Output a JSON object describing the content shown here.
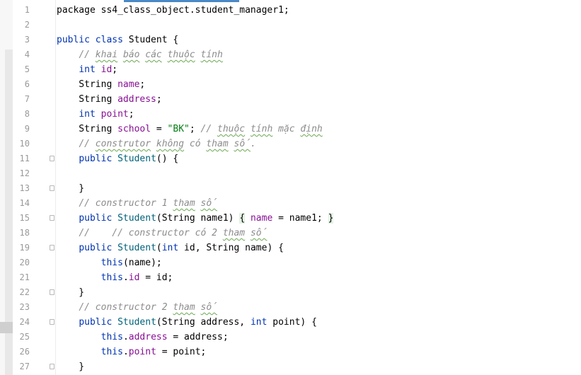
{
  "editor": {
    "lines": [
      {
        "num": "1",
        "fold": false,
        "tokens": [
          {
            "t": "package ss4_class_object.student_manager1;",
            "c": ""
          }
        ]
      },
      {
        "num": "2",
        "fold": false,
        "tokens": []
      },
      {
        "num": "3",
        "fold": false,
        "tokens": [
          {
            "t": "public class ",
            "c": "kw"
          },
          {
            "t": "Student {",
            "c": ""
          }
        ]
      },
      {
        "num": "4",
        "fold": false,
        "tokens": [
          {
            "t": "    ",
            "c": ""
          },
          {
            "t": "// ",
            "c": "cm"
          },
          {
            "t": "khai",
            "c": "cm sq"
          },
          {
            "t": " ",
            "c": "cm"
          },
          {
            "t": "báo",
            "c": "cm sq"
          },
          {
            "t": " ",
            "c": "cm"
          },
          {
            "t": "các",
            "c": "cm sq"
          },
          {
            "t": " ",
            "c": "cm"
          },
          {
            "t": "thuộc",
            "c": "cm sq"
          },
          {
            "t": " ",
            "c": "cm"
          },
          {
            "t": "tính",
            "c": "cm sq"
          }
        ]
      },
      {
        "num": "5",
        "fold": false,
        "tokens": [
          {
            "t": "    ",
            "c": ""
          },
          {
            "t": "int ",
            "c": "kw"
          },
          {
            "t": "id",
            "c": "fld"
          },
          {
            "t": ";",
            "c": ""
          }
        ]
      },
      {
        "num": "6",
        "fold": false,
        "tokens": [
          {
            "t": "    String ",
            "c": ""
          },
          {
            "t": "name",
            "c": "fld"
          },
          {
            "t": ";",
            "c": ""
          }
        ]
      },
      {
        "num": "7",
        "fold": false,
        "tokens": [
          {
            "t": "    String ",
            "c": ""
          },
          {
            "t": "address",
            "c": "fld"
          },
          {
            "t": ";",
            "c": ""
          }
        ]
      },
      {
        "num": "8",
        "fold": false,
        "tokens": [
          {
            "t": "    ",
            "c": ""
          },
          {
            "t": "int ",
            "c": "kw"
          },
          {
            "t": "point",
            "c": "fld"
          },
          {
            "t": ";",
            "c": ""
          }
        ]
      },
      {
        "num": "9",
        "fold": false,
        "tokens": [
          {
            "t": "    String ",
            "c": ""
          },
          {
            "t": "school",
            "c": "fld"
          },
          {
            "t": " = ",
            "c": ""
          },
          {
            "t": "\"BK\"",
            "c": "str"
          },
          {
            "t": "; ",
            "c": ""
          },
          {
            "t": "// ",
            "c": "cm"
          },
          {
            "t": "thuộc",
            "c": "cm sq"
          },
          {
            "t": " ",
            "c": "cm"
          },
          {
            "t": "tính",
            "c": "cm sq"
          },
          {
            "t": " mặc ",
            "c": "cm"
          },
          {
            "t": "định",
            "c": "cm sq"
          }
        ]
      },
      {
        "num": "10",
        "fold": false,
        "tokens": [
          {
            "t": "    ",
            "c": ""
          },
          {
            "t": "// ",
            "c": "cm"
          },
          {
            "t": "construtor",
            "c": "cm sq"
          },
          {
            "t": " ",
            "c": "cm"
          },
          {
            "t": "không",
            "c": "cm sq"
          },
          {
            "t": " có ",
            "c": "cm"
          },
          {
            "t": "tham",
            "c": "cm sq"
          },
          {
            "t": " ",
            "c": "cm"
          },
          {
            "t": "số",
            "c": "cm sq"
          },
          {
            "t": ".",
            "c": "cm"
          }
        ]
      },
      {
        "num": "11",
        "fold": true,
        "tokens": [
          {
            "t": "    ",
            "c": ""
          },
          {
            "t": "public ",
            "c": "kw"
          },
          {
            "t": "Student",
            "c": "ctor"
          },
          {
            "t": "() {",
            "c": ""
          }
        ]
      },
      {
        "num": "12",
        "fold": false,
        "tokens": []
      },
      {
        "num": "13",
        "fold": true,
        "tokens": [
          {
            "t": "    }",
            "c": ""
          }
        ]
      },
      {
        "num": "14",
        "fold": false,
        "tokens": [
          {
            "t": "    ",
            "c": ""
          },
          {
            "t": "// constructor 1 ",
            "c": "cm"
          },
          {
            "t": "tham",
            "c": "cm sq"
          },
          {
            "t": " ",
            "c": "cm"
          },
          {
            "t": "số",
            "c": "cm sq"
          }
        ]
      },
      {
        "num": "15",
        "fold": true,
        "tokens": [
          {
            "t": "    ",
            "c": ""
          },
          {
            "t": "public ",
            "c": "kw"
          },
          {
            "t": "Student",
            "c": "ctor"
          },
          {
            "t": "(String name1) ",
            "c": ""
          },
          {
            "t": "{",
            "c": "fh"
          },
          {
            "t": " ",
            "c": ""
          },
          {
            "t": "name",
            "c": "fld"
          },
          {
            "t": " = name1; ",
            "c": ""
          },
          {
            "t": "}",
            "c": "fh"
          }
        ]
      },
      {
        "num": "18",
        "fold": false,
        "tokens": [
          {
            "t": "    ",
            "c": ""
          },
          {
            "t": "//    // constructor có 2 ",
            "c": "cm"
          },
          {
            "t": "tham",
            "c": "cm sq"
          },
          {
            "t": " ",
            "c": "cm"
          },
          {
            "t": "số",
            "c": "cm sq"
          }
        ]
      },
      {
        "num": "19",
        "fold": true,
        "tokens": [
          {
            "t": "    ",
            "c": ""
          },
          {
            "t": "public ",
            "c": "kw"
          },
          {
            "t": "Student",
            "c": "ctor"
          },
          {
            "t": "(",
            "c": ""
          },
          {
            "t": "int ",
            "c": "kw"
          },
          {
            "t": "id, String name) {",
            "c": ""
          }
        ]
      },
      {
        "num": "20",
        "fold": false,
        "tokens": [
          {
            "t": "        ",
            "c": ""
          },
          {
            "t": "this",
            "c": "kw"
          },
          {
            "t": "(name);",
            "c": ""
          }
        ]
      },
      {
        "num": "21",
        "fold": false,
        "tokens": [
          {
            "t": "        ",
            "c": ""
          },
          {
            "t": "this",
            "c": "kw"
          },
          {
            "t": ".",
            "c": ""
          },
          {
            "t": "id",
            "c": "fld"
          },
          {
            "t": " = id;",
            "c": ""
          }
        ]
      },
      {
        "num": "22",
        "fold": true,
        "tokens": [
          {
            "t": "    }",
            "c": ""
          }
        ]
      },
      {
        "num": "23",
        "fold": false,
        "tokens": [
          {
            "t": "    ",
            "c": ""
          },
          {
            "t": "// constructor 2 ",
            "c": "cm"
          },
          {
            "t": "tham",
            "c": "cm sq"
          },
          {
            "t": " ",
            "c": "cm"
          },
          {
            "t": "số",
            "c": "cm sq"
          }
        ]
      },
      {
        "num": "24",
        "fold": true,
        "tokens": [
          {
            "t": "    ",
            "c": ""
          },
          {
            "t": "public ",
            "c": "kw"
          },
          {
            "t": "Student",
            "c": "ctor"
          },
          {
            "t": "(String address, ",
            "c": ""
          },
          {
            "t": "int ",
            "c": "kw"
          },
          {
            "t": "point) {",
            "c": ""
          }
        ]
      },
      {
        "num": "25",
        "fold": false,
        "tokens": [
          {
            "t": "        ",
            "c": ""
          },
          {
            "t": "this",
            "c": "kw"
          },
          {
            "t": ".",
            "c": ""
          },
          {
            "t": "address",
            "c": "fld"
          },
          {
            "t": " = address;",
            "c": ""
          }
        ]
      },
      {
        "num": "26",
        "fold": false,
        "tokens": [
          {
            "t": "        ",
            "c": ""
          },
          {
            "t": "this",
            "c": "kw"
          },
          {
            "t": ".",
            "c": ""
          },
          {
            "t": "point",
            "c": "fld"
          },
          {
            "t": " = point;",
            "c": ""
          }
        ]
      },
      {
        "num": "27",
        "fold": true,
        "tokens": [
          {
            "t": "    }",
            "c": ""
          }
        ]
      }
    ]
  }
}
